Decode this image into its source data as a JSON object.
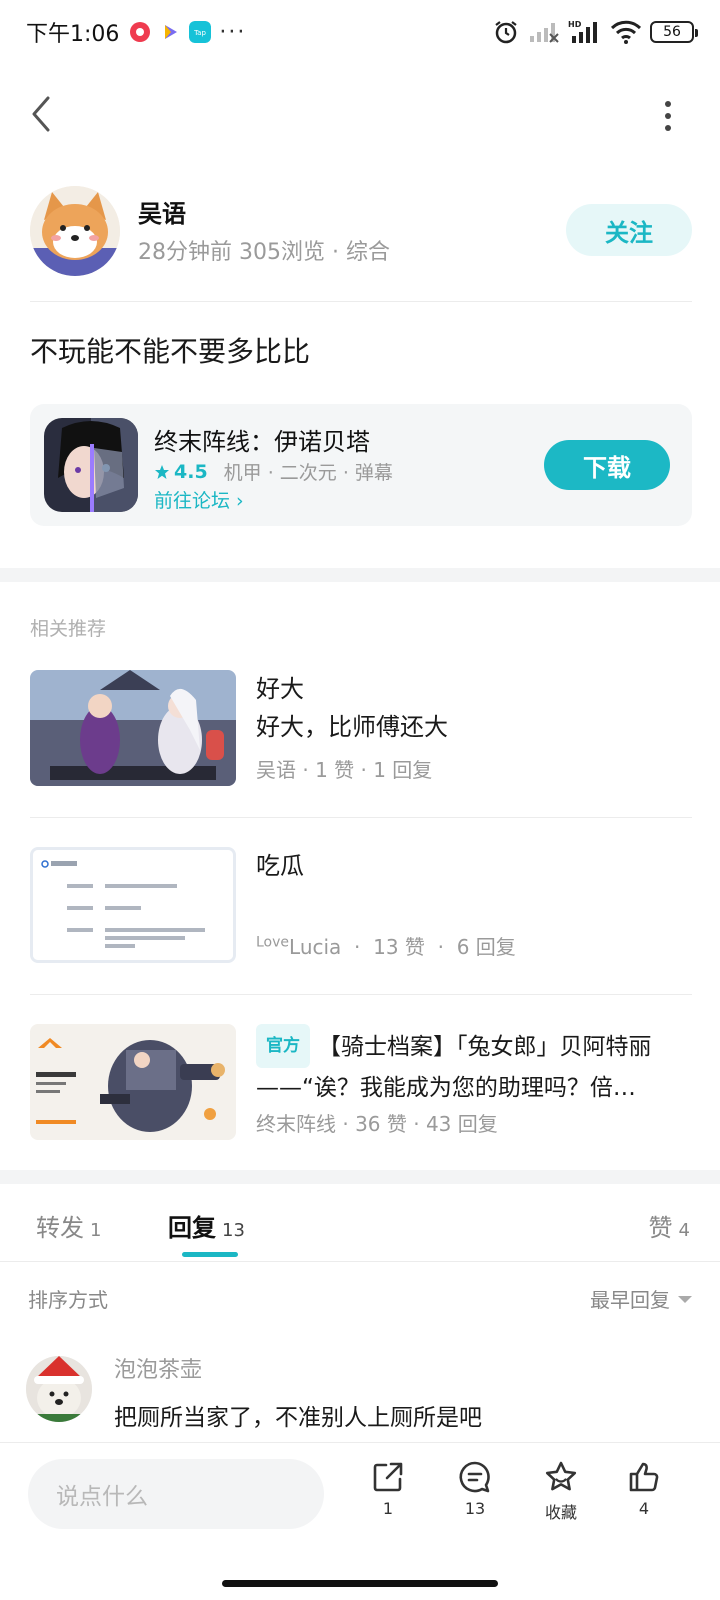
{
  "status_bar": {
    "time": "下午1:06",
    "more": "···",
    "battery": "56"
  },
  "author": {
    "name": "吴语",
    "meta": "28分钟前  305浏览  ·  综合",
    "follow_label": "关注"
  },
  "post": {
    "text": "不玩能不能不要多比比"
  },
  "game": {
    "name": "终末阵线：伊诺贝塔",
    "rating": "4.5",
    "tags": "机甲  ·  二次元  ·  弹幕",
    "forum_link": "前往论坛 ›",
    "download_label": "下载"
  },
  "related": {
    "title": "相关推荐",
    "items": [
      {
        "title": "好大",
        "subtitle": "好大，比师傅还大",
        "meta": "吴语  ·  1 赞  ·  1 回复"
      },
      {
        "title": "吃瓜",
        "subtitle": "",
        "meta_user_sup": "Love",
        "meta_user": "Lucia",
        "meta_rest": "  ·  13 赞  ·  6 回复"
      },
      {
        "badge": "官方",
        "title": "【骑士档案】「兔女郎」贝阿特丽——“诶？我能成为您的助理吗？倍…",
        "meta": "终末阵线  ·  36 赞  ·  43 回复"
      }
    ]
  },
  "tabs": {
    "repost_label": "转发",
    "repost_count": "1",
    "reply_label": "回复",
    "reply_count": "13",
    "like_label": "赞",
    "like_count": "4"
  },
  "sort": {
    "label": "排序方式",
    "value": "最早回复"
  },
  "comment": {
    "user": "泡泡茶壶",
    "text": "把厕所当家了，不准别人上厕所是吧"
  },
  "bottom_bar": {
    "input_placeholder": "说点什么",
    "share_count": "1",
    "comment_count": "13",
    "favorite_label": "收藏",
    "like_count": "4"
  },
  "colors": {
    "accent": "#1bb7c4",
    "accent_light": "#e6f7f8",
    "muted_text": "#9a9a9a"
  }
}
